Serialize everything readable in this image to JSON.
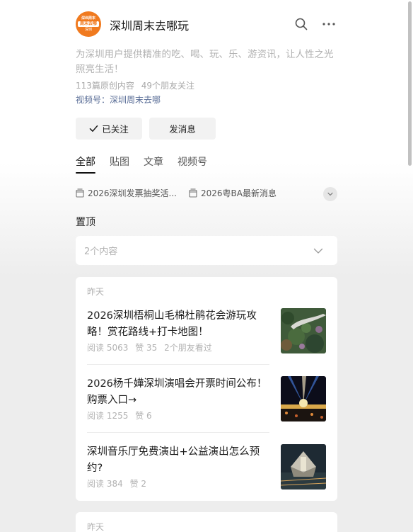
{
  "profile": {
    "avatar_line1": "深圳周末",
    "avatar_line2": "周末去哪",
    "avatar_line3": "深圳",
    "name": "深圳周末去哪玩",
    "description": "为深圳用户提供精准的吃、喝、玩、乐、游资讯，让人性之光照亮生活！",
    "original_count": "113篇原创内容",
    "friends_following": "49个朋友关注",
    "channel": "视频号：深圳周末去哪",
    "followed_label": "已关注",
    "message_label": "发消息"
  },
  "header_icons": [
    "search-icon",
    "more-icon"
  ],
  "tabs": [
    {
      "label": "全部",
      "active": true
    },
    {
      "label": "贴图",
      "active": false
    },
    {
      "label": "文章",
      "active": false
    },
    {
      "label": "视频号",
      "active": false
    }
  ],
  "collections": [
    {
      "label": "2026深圳发票抽奖活..."
    },
    {
      "label": "2026粤BA最新消息"
    }
  ],
  "pinned": {
    "label": "置顶",
    "summary": "2个内容"
  },
  "groups": [
    {
      "date": "昨天",
      "articles": [
        {
          "title": "2026深圳梧桐山毛棉杜鹃花会游玩攻略！赏花路线+打卡地图！",
          "reads": "阅读 5063",
          "likes": "赞 35",
          "friends": "2个朋友看过",
          "thumb": "mountain-aerial"
        },
        {
          "title": "2026杨千嬅深圳演唱会开票时间公布！购票入口→",
          "reads": "阅读 1255",
          "likes": "赞 6",
          "thumb": "concert-stage"
        },
        {
          "title": "深圳音乐厅免费演出+公益演出怎么预约?",
          "reads": "阅读 384",
          "likes": "赞 2",
          "thumb": "concert-hall-night"
        }
      ]
    },
    {
      "date": "昨天",
      "articles": []
    }
  ],
  "colors": {
    "accent_link": "#576b95",
    "avatar_orange": "#f07a1f",
    "muted_text": "#b2b2b2",
    "background_gray": "#ededed"
  }
}
